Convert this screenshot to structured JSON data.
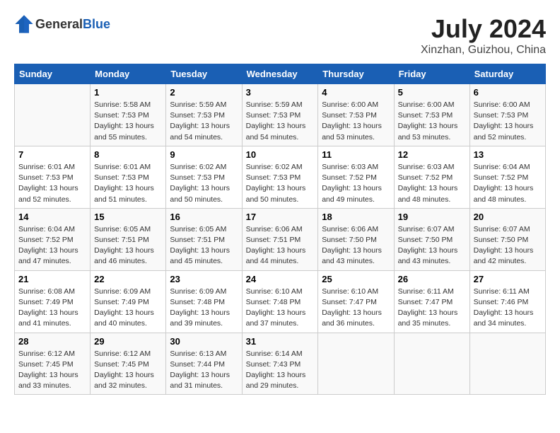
{
  "header": {
    "logo_general": "General",
    "logo_blue": "Blue",
    "month_year": "July 2024",
    "location": "Xinzhan, Guizhou, China"
  },
  "weekdays": [
    "Sunday",
    "Monday",
    "Tuesday",
    "Wednesday",
    "Thursday",
    "Friday",
    "Saturday"
  ],
  "weeks": [
    [
      {
        "day": "",
        "sunrise": "",
        "sunset": "",
        "daylight": ""
      },
      {
        "day": "1",
        "sunrise": "Sunrise: 5:58 AM",
        "sunset": "Sunset: 7:53 PM",
        "daylight": "Daylight: 13 hours and 55 minutes."
      },
      {
        "day": "2",
        "sunrise": "Sunrise: 5:59 AM",
        "sunset": "Sunset: 7:53 PM",
        "daylight": "Daylight: 13 hours and 54 minutes."
      },
      {
        "day": "3",
        "sunrise": "Sunrise: 5:59 AM",
        "sunset": "Sunset: 7:53 PM",
        "daylight": "Daylight: 13 hours and 54 minutes."
      },
      {
        "day": "4",
        "sunrise": "Sunrise: 6:00 AM",
        "sunset": "Sunset: 7:53 PM",
        "daylight": "Daylight: 13 hours and 53 minutes."
      },
      {
        "day": "5",
        "sunrise": "Sunrise: 6:00 AM",
        "sunset": "Sunset: 7:53 PM",
        "daylight": "Daylight: 13 hours and 53 minutes."
      },
      {
        "day": "6",
        "sunrise": "Sunrise: 6:00 AM",
        "sunset": "Sunset: 7:53 PM",
        "daylight": "Daylight: 13 hours and 52 minutes."
      }
    ],
    [
      {
        "day": "7",
        "sunrise": "Sunrise: 6:01 AM",
        "sunset": "Sunset: 7:53 PM",
        "daylight": "Daylight: 13 hours and 52 minutes."
      },
      {
        "day": "8",
        "sunrise": "Sunrise: 6:01 AM",
        "sunset": "Sunset: 7:53 PM",
        "daylight": "Daylight: 13 hours and 51 minutes."
      },
      {
        "day": "9",
        "sunrise": "Sunrise: 6:02 AM",
        "sunset": "Sunset: 7:53 PM",
        "daylight": "Daylight: 13 hours and 50 minutes."
      },
      {
        "day": "10",
        "sunrise": "Sunrise: 6:02 AM",
        "sunset": "Sunset: 7:53 PM",
        "daylight": "Daylight: 13 hours and 50 minutes."
      },
      {
        "day": "11",
        "sunrise": "Sunrise: 6:03 AM",
        "sunset": "Sunset: 7:52 PM",
        "daylight": "Daylight: 13 hours and 49 minutes."
      },
      {
        "day": "12",
        "sunrise": "Sunrise: 6:03 AM",
        "sunset": "Sunset: 7:52 PM",
        "daylight": "Daylight: 13 hours and 48 minutes."
      },
      {
        "day": "13",
        "sunrise": "Sunrise: 6:04 AM",
        "sunset": "Sunset: 7:52 PM",
        "daylight": "Daylight: 13 hours and 48 minutes."
      }
    ],
    [
      {
        "day": "14",
        "sunrise": "Sunrise: 6:04 AM",
        "sunset": "Sunset: 7:52 PM",
        "daylight": "Daylight: 13 hours and 47 minutes."
      },
      {
        "day": "15",
        "sunrise": "Sunrise: 6:05 AM",
        "sunset": "Sunset: 7:51 PM",
        "daylight": "Daylight: 13 hours and 46 minutes."
      },
      {
        "day": "16",
        "sunrise": "Sunrise: 6:05 AM",
        "sunset": "Sunset: 7:51 PM",
        "daylight": "Daylight: 13 hours and 45 minutes."
      },
      {
        "day": "17",
        "sunrise": "Sunrise: 6:06 AM",
        "sunset": "Sunset: 7:51 PM",
        "daylight": "Daylight: 13 hours and 44 minutes."
      },
      {
        "day": "18",
        "sunrise": "Sunrise: 6:06 AM",
        "sunset": "Sunset: 7:50 PM",
        "daylight": "Daylight: 13 hours and 43 minutes."
      },
      {
        "day": "19",
        "sunrise": "Sunrise: 6:07 AM",
        "sunset": "Sunset: 7:50 PM",
        "daylight": "Daylight: 13 hours and 43 minutes."
      },
      {
        "day": "20",
        "sunrise": "Sunrise: 6:07 AM",
        "sunset": "Sunset: 7:50 PM",
        "daylight": "Daylight: 13 hours and 42 minutes."
      }
    ],
    [
      {
        "day": "21",
        "sunrise": "Sunrise: 6:08 AM",
        "sunset": "Sunset: 7:49 PM",
        "daylight": "Daylight: 13 hours and 41 minutes."
      },
      {
        "day": "22",
        "sunrise": "Sunrise: 6:09 AM",
        "sunset": "Sunset: 7:49 PM",
        "daylight": "Daylight: 13 hours and 40 minutes."
      },
      {
        "day": "23",
        "sunrise": "Sunrise: 6:09 AM",
        "sunset": "Sunset: 7:48 PM",
        "daylight": "Daylight: 13 hours and 39 minutes."
      },
      {
        "day": "24",
        "sunrise": "Sunrise: 6:10 AM",
        "sunset": "Sunset: 7:48 PM",
        "daylight": "Daylight: 13 hours and 37 minutes."
      },
      {
        "day": "25",
        "sunrise": "Sunrise: 6:10 AM",
        "sunset": "Sunset: 7:47 PM",
        "daylight": "Daylight: 13 hours and 36 minutes."
      },
      {
        "day": "26",
        "sunrise": "Sunrise: 6:11 AM",
        "sunset": "Sunset: 7:47 PM",
        "daylight": "Daylight: 13 hours and 35 minutes."
      },
      {
        "day": "27",
        "sunrise": "Sunrise: 6:11 AM",
        "sunset": "Sunset: 7:46 PM",
        "daylight": "Daylight: 13 hours and 34 minutes."
      }
    ],
    [
      {
        "day": "28",
        "sunrise": "Sunrise: 6:12 AM",
        "sunset": "Sunset: 7:45 PM",
        "daylight": "Daylight: 13 hours and 33 minutes."
      },
      {
        "day": "29",
        "sunrise": "Sunrise: 6:12 AM",
        "sunset": "Sunset: 7:45 PM",
        "daylight": "Daylight: 13 hours and 32 minutes."
      },
      {
        "day": "30",
        "sunrise": "Sunrise: 6:13 AM",
        "sunset": "Sunset: 7:44 PM",
        "daylight": "Daylight: 13 hours and 31 minutes."
      },
      {
        "day": "31",
        "sunrise": "Sunrise: 6:14 AM",
        "sunset": "Sunset: 7:43 PM",
        "daylight": "Daylight: 13 hours and 29 minutes."
      },
      {
        "day": "",
        "sunrise": "",
        "sunset": "",
        "daylight": ""
      },
      {
        "day": "",
        "sunrise": "",
        "sunset": "",
        "daylight": ""
      },
      {
        "day": "",
        "sunrise": "",
        "sunset": "",
        "daylight": ""
      }
    ]
  ]
}
